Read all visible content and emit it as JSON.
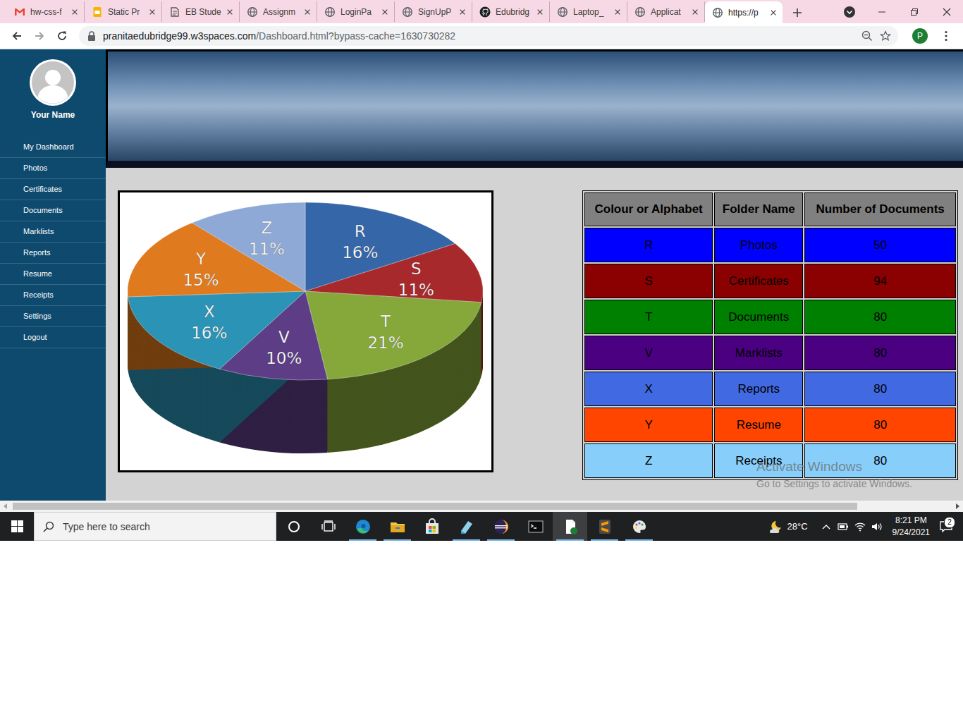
{
  "browser": {
    "tabs": [
      {
        "label": "hw-css-f",
        "kind": "mail",
        "selected": false
      },
      {
        "label": "Static Pr",
        "kind": "slides",
        "selected": false
      },
      {
        "label": "EB Stude",
        "kind": "doc",
        "selected": false
      },
      {
        "label": "Assignm",
        "kind": "web",
        "selected": false
      },
      {
        "label": "LoginPa",
        "kind": "web",
        "selected": false
      },
      {
        "label": "SignUpP",
        "kind": "web",
        "selected": false
      },
      {
        "label": "Edubridg",
        "kind": "github",
        "selected": false
      },
      {
        "label": "Laptop_",
        "kind": "web",
        "selected": false
      },
      {
        "label": "Applicat",
        "kind": "web",
        "selected": false
      },
      {
        "label": "https://p",
        "kind": "web",
        "selected": true
      }
    ],
    "address": {
      "host": "pranitaedubridge99.w3spaces.com",
      "path": "/Dashboard.html?bypass-cache=1630730282"
    },
    "profile": "P"
  },
  "sidebar": {
    "user": "Your Name",
    "items": [
      "My Dashboard",
      "Photos",
      "Certificates",
      "Documents",
      "Marklists",
      "Reports",
      "Resume",
      "Receipts",
      "Settings",
      "Logout"
    ]
  },
  "chart": {
    "slices": [
      {
        "label": "R",
        "value": 16,
        "text": "16%",
        "color": "#3566a8"
      },
      {
        "label": "S",
        "value": 11,
        "text": "11%",
        "color": "#a8292c"
      },
      {
        "label": "T",
        "value": 21,
        "text": "21%",
        "color": "#86a83a"
      },
      {
        "label": "V",
        "value": 10,
        "text": "10%",
        "color": "#5c3d86"
      },
      {
        "label": "X",
        "value": 16,
        "text": "16%",
        "color": "#2b93b5"
      },
      {
        "label": "Y",
        "value": 15,
        "text": "15%",
        "color": "#e07a1e"
      },
      {
        "label": "Z",
        "value": 11,
        "text": "11%",
        "color": "#8ea9d6"
      }
    ]
  },
  "table": {
    "columns": [
      "Colour or Alphabet",
      "Folder Name",
      "Number of Documents"
    ],
    "rows": [
      {
        "cells": [
          "R",
          "Photos",
          "50"
        ],
        "color": "#0000ff"
      },
      {
        "cells": [
          "S",
          "Certificates",
          "94"
        ],
        "color": "#8b0000"
      },
      {
        "cells": [
          "T",
          "Documents",
          "80"
        ],
        "color": "#008000"
      },
      {
        "cells": [
          "V",
          "Marklists",
          "80"
        ],
        "color": "#4b0082"
      },
      {
        "cells": [
          "X",
          "Reports",
          "80"
        ],
        "color": "#4169e1"
      },
      {
        "cells": [
          "Y",
          "Resume",
          "80"
        ],
        "color": "#ff4500"
      },
      {
        "cells": [
          "Z",
          "Receipts",
          "80"
        ],
        "color": "#87cefa"
      }
    ]
  },
  "watermark": {
    "title": "Activate Windows",
    "subtitle": "Go to Settings to activate Windows."
  },
  "taskbar": {
    "search": "Type here to search",
    "apps": [
      {
        "kind": "edge",
        "running": true,
        "selected": false
      },
      {
        "kind": "explorer",
        "running": true,
        "selected": false
      },
      {
        "kind": "store",
        "running": false,
        "selected": false
      },
      {
        "kind": "notes",
        "running": true,
        "selected": false
      },
      {
        "kind": "eclipse",
        "running": true,
        "selected": false
      },
      {
        "kind": "terminal",
        "running": false,
        "selected": false
      },
      {
        "kind": "notepad",
        "running": true,
        "selected": true
      },
      {
        "kind": "sublime",
        "running": true,
        "selected": false
      },
      {
        "kind": "paint",
        "running": true,
        "selected": false
      }
    ],
    "weather": "28°C",
    "time": "8:21 PM",
    "date": "9/24/2021",
    "notifications": "2"
  }
}
